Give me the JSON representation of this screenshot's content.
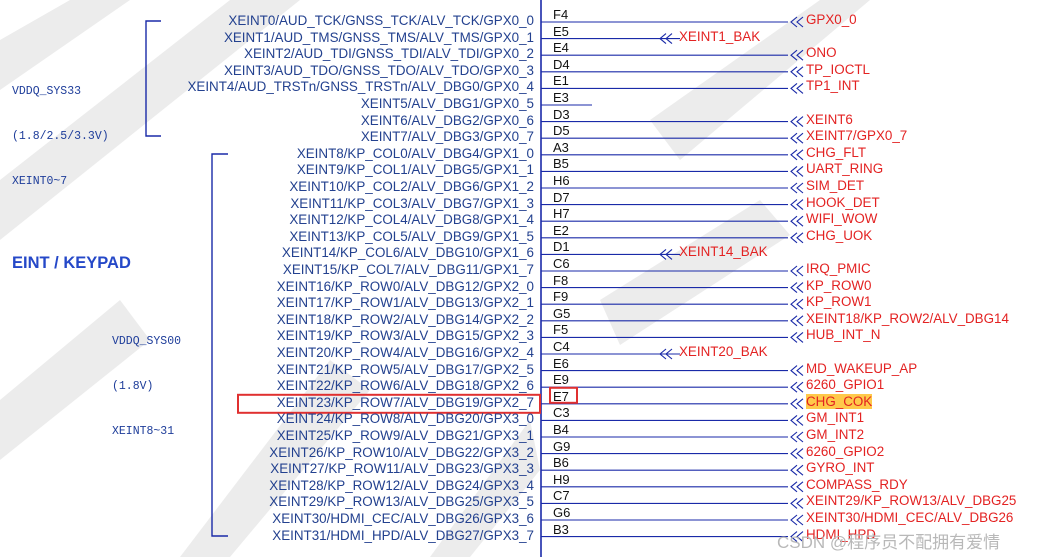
{
  "title": "EINT / KEYPAD",
  "groups": [
    {
      "lines": [
        "VDDQ_SYS33",
        "(1.8/2.5/3.3V)",
        "XEINT0~7"
      ]
    },
    {
      "lines": [
        "VDDQ_SYS00",
        "(1.8V)",
        "XEINT8~31"
      ]
    }
  ],
  "pins": [
    {
      "name": "XEINT0/AUD_TCK/GNSS_TCK/ALV_TCK/GPX0_0",
      "ball": "F4",
      "net": "GPX0_0",
      "net_style": "arrow"
    },
    {
      "name": "XEINT1/AUD_TMS/GNSS_TMS/ALV_TMS/GPX0_1",
      "ball": "E5",
      "net": "XEINT1_BAK",
      "net_style": "offpage"
    },
    {
      "name": "XEINT2/AUD_TDI/GNSS_TDI/ALV_TDI/GPX0_2",
      "ball": "E4",
      "net": "ONO",
      "net_style": "arrow"
    },
    {
      "name": "XEINT3/AUD_TDO/GNSS_TDO/ALV_TDO/GPX0_3",
      "ball": "D4",
      "net": "TP_IOCTL",
      "net_style": "arrow"
    },
    {
      "name": "XEINT4/AUD_TRSTn/GNSS_TRSTn/ALV_DBG0/GPX0_4",
      "ball": "E1",
      "net": "TP1_INT",
      "net_style": "arrow"
    },
    {
      "name": "XEINT5/ALV_DBG1/GPX0_5",
      "ball": "E3",
      "net": "",
      "net_style": "stub"
    },
    {
      "name": "XEINT6/ALV_DBG2/GPX0_6",
      "ball": "D3",
      "net": "XEINT6",
      "net_style": "arrow"
    },
    {
      "name": "XEINT7/ALV_DBG3/GPX0_7",
      "ball": "D5",
      "net": "XEINT7/GPX0_7",
      "net_style": "arrow"
    },
    {
      "name": "XEINT8/KP_COL0/ALV_DBG4/GPX1_0",
      "ball": "A3",
      "net": "CHG_FLT",
      "net_style": "arrow"
    },
    {
      "name": "XEINT9/KP_COL1/ALV_DBG5/GPX1_1",
      "ball": "B5",
      "net": "UART_RING",
      "net_style": "arrow"
    },
    {
      "name": "XEINT10/KP_COL2/ALV_DBG6/GPX1_2",
      "ball": "H6",
      "net": "SIM_DET",
      "net_style": "arrow"
    },
    {
      "name": "XEINT11/KP_COL3/ALV_DBG7/GPX1_3",
      "ball": "D7",
      "net": "HOOK_DET",
      "net_style": "arrow"
    },
    {
      "name": "XEINT12/KP_COL4/ALV_DBG8/GPX1_4",
      "ball": "H7",
      "net": "WIFI_WOW",
      "net_style": "arrow"
    },
    {
      "name": "XEINT13/KP_COL5/ALV_DBG9/GPX1_5",
      "ball": "E2",
      "net": "CHG_UOK",
      "net_style": "arrow"
    },
    {
      "name": "XEINT14/KP_COL6/ALV_DBG10/GPX1_6",
      "ball": "D1",
      "net": "XEINT14_BAK",
      "net_style": "offpage"
    },
    {
      "name": "XEINT15/KP_COL7/ALV_DBG11/GPX1_7",
      "ball": "C6",
      "net": "IRQ_PMIC",
      "net_style": "arrow"
    },
    {
      "name": "XEINT16/KP_ROW0/ALV_DBG12/GPX2_0",
      "ball": "F8",
      "net": "KP_ROW0",
      "net_style": "arrow"
    },
    {
      "name": "XEINT17/KP_ROW1/ALV_DBG13/GPX2_1",
      "ball": "F9",
      "net": "KP_ROW1",
      "net_style": "arrow"
    },
    {
      "name": "XEINT18/KP_ROW2/ALV_DBG14/GPX2_2",
      "ball": "G5",
      "net": "XEINT18/KP_ROW2/ALV_DBG14",
      "net_style": "arrow"
    },
    {
      "name": "XEINT19/KP_ROW3/ALV_DBG15/GPX2_3",
      "ball": "F5",
      "net": "HUB_INT_N",
      "net_style": "arrow"
    },
    {
      "name": "XEINT20/KP_ROW4/ALV_DBG16/GPX2_4",
      "ball": "C4",
      "net": "XEINT20_BAK",
      "net_style": "offpage"
    },
    {
      "name": "XEINT21/KP_ROW5/ALV_DBG17/GPX2_5",
      "ball": "E6",
      "net": "MD_WAKEUP_AP",
      "net_style": "arrow"
    },
    {
      "name": "XEINT22/KP_ROW6/ALV_DBG18/GPX2_6",
      "ball": "E9",
      "net": "6260_GPIO1",
      "net_style": "arrow"
    },
    {
      "name": "XEINT23/KP_ROW7/ALV_DBG19/GPX2_7",
      "ball": "E7",
      "net": "CHG_COK",
      "net_style": "arrow"
    },
    {
      "name": "XEINT24/KP_ROW8/ALV_DBG20/GPX3_0",
      "ball": "C3",
      "net": "GM_INT1",
      "net_style": "arrow"
    },
    {
      "name": "XEINT25/KP_ROW9/ALV_DBG21/GPX3_1",
      "ball": "B4",
      "net": "GM_INT2",
      "net_style": "arrow"
    },
    {
      "name": "XEINT26/KP_ROW10/ALV_DBG22/GPX3_2",
      "ball": "G9",
      "net": "6260_GPIO2",
      "net_style": "arrow"
    },
    {
      "name": "XEINT27/KP_ROW11/ALV_DBG23/GPX3_3",
      "ball": "B6",
      "net": "GYRO_INT",
      "net_style": "arrow"
    },
    {
      "name": "XEINT28/KP_ROW12/ALV_DBG24/GPX3_4",
      "ball": "H9",
      "net": "COMPASS_RDY",
      "net_style": "arrow"
    },
    {
      "name": "XEINT29/KP_ROW13/ALV_DBG25/GPX3_5",
      "ball": "C7",
      "net": "XEINT29/KP_ROW13/ALV_DBG25",
      "net_style": "arrow"
    },
    {
      "name": "XEINT30/HDMI_CEC/ALV_DBG26/GPX3_6",
      "ball": "G6",
      "net": "XEINT30/HDMI_CEC/ALV_DBG26",
      "net_style": "arrow"
    },
    {
      "name": "XEINT31/HDMI_HPD/ALV_DBG27/GPX3_7",
      "ball": "B3",
      "net": "HDMI_HPD",
      "net_style": "arrow"
    }
  ],
  "highlight": {
    "pin": "XEINT23/KP_ROW7/ALV_DBG19/GPX2_7",
    "ball": "E7",
    "net": "CHG_COK",
    "box_color": "#e03030",
    "fill_color": "#ffc94a"
  },
  "watermark": "CSDN @程序员不配拥有爱情",
  "colors": {
    "pin_text": "#23418f",
    "net_text": "#e32222",
    "line": "#1a2aa8",
    "title": "#2548c8"
  }
}
